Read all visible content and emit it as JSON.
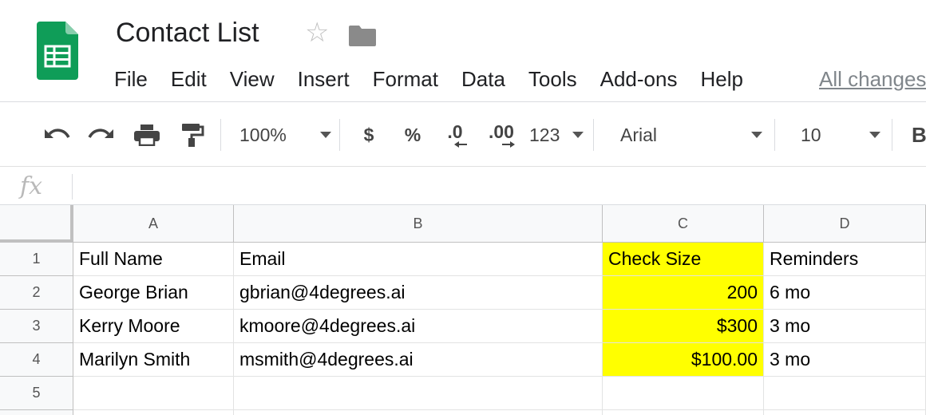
{
  "app": {
    "document_title": "Contact List",
    "icons": {
      "logo": "google-sheets-logo-icon",
      "star": "star-icon",
      "folder": "folder-icon"
    },
    "brand_color": "#0f9d58",
    "save_status": "All changes"
  },
  "menu": {
    "items": [
      "File",
      "Edit",
      "View",
      "Insert",
      "Format",
      "Data",
      "Tools",
      "Add-ons",
      "Help"
    ]
  },
  "toolbar": {
    "undo_icon": "undo-icon",
    "redo_icon": "redo-icon",
    "print_icon": "print-icon",
    "paint_format_icon": "paint-format-icon",
    "zoom": "100%",
    "currency": "$",
    "percent": "%",
    "decrease_decimal": ".0",
    "increase_decimal": ".00",
    "more_formats": "123",
    "font": "Arial",
    "font_size": "10",
    "bold": "B"
  },
  "formula_bar": {
    "label": "fx",
    "value": ""
  },
  "sheet": {
    "columns": [
      "A",
      "B",
      "C",
      "D"
    ],
    "rows": [
      "1",
      "2",
      "3",
      "4",
      "5"
    ],
    "highlight_color": "#ffff00",
    "cells": [
      [
        "Full Name",
        "Email",
        "Check Size",
        "Reminders"
      ],
      [
        "George Brian",
        "gbrian@4degrees.ai",
        "200",
        "6 mo"
      ],
      [
        "Kerry Moore",
        "kmoore@4degrees.ai",
        "$300",
        "3 mo"
      ],
      [
        "Marilyn Smith",
        "msmith@4degrees.ai",
        "$100.00",
        "3 mo"
      ],
      [
        "",
        "",
        "",
        ""
      ]
    ]
  }
}
